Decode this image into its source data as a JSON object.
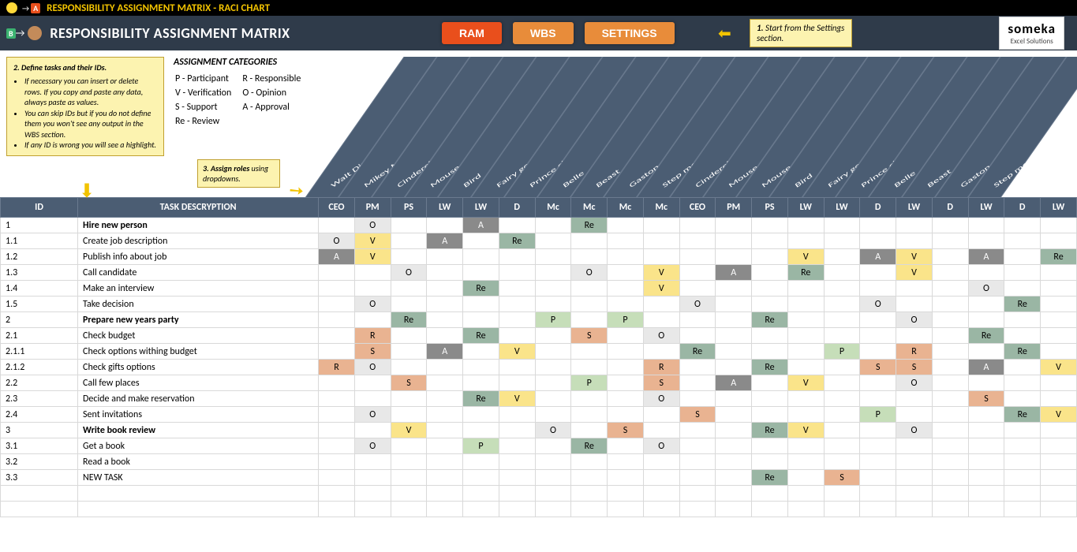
{
  "topbar": {
    "title": "RESPONSIBILITY ASSIGNMENT MATRIX - RACI CHART"
  },
  "header": {
    "title": "RESPONSIBILITY ASSIGNMENT MATRIX",
    "btn_ram": "RAM",
    "btn_wbs": "WBS",
    "btn_settings": "SETTINGS",
    "instr1_strong": "1.",
    "instr1_rest": " Start from the Settings section.",
    "logo_line1": "someka",
    "logo_line2": "Excel Solutions"
  },
  "instr2": {
    "head": "2. Define tasks and their IDs.",
    "li1": "If necessary you can insert or delete rows. If you copy and paste any data, always paste as values.",
    "li2": "You can skip IDs but if you do not define them you won't see any output in the WBS section.",
    "li3": "If any ID is wrong you will see a highlight."
  },
  "categories": {
    "head": "ASSIGNMENT CATEGORIES",
    "p": "P - Participant",
    "r": "R - Responsible",
    "v": "V - Verification",
    "o": "O - Opinion",
    "s": "S - Support",
    "a": "A - Approval",
    "re": "Re - Review"
  },
  "instr3_strong": "3. Assign roles",
  "instr3_rest": " using dropdowns.",
  "col_id": "ID",
  "col_desc": "TASK DESCRYPTION",
  "people": [
    "Walt Disney",
    "Mikey Mouse",
    "Cinderella",
    "Mouse",
    "Bird",
    "Fairy godmother",
    "Prince charming",
    "Belle",
    "Beast",
    "Gaston",
    "Step mother",
    "Cinderella",
    "Mouse",
    "Mouse",
    "Bird",
    "Fairy godmother",
    "Prince charming",
    "Belle",
    "Beast",
    "Gaston",
    "Step mother"
  ],
  "roles": [
    "CEO",
    "PM",
    "PS",
    "LW",
    "LW",
    "D",
    "Mc",
    "Mc",
    "Mc",
    "Mc",
    "CEO",
    "PM",
    "PS",
    "LW",
    "LW",
    "D",
    "LW",
    "D",
    "LW",
    "D",
    "LW"
  ],
  "rows": [
    {
      "id": "1",
      "desc": "Hire new person",
      "bold": true,
      "c": [
        "",
        "O",
        "",
        "",
        "A",
        "",
        "",
        "Re",
        "",
        "",
        "",
        "",
        "",
        "",
        "",
        "",
        "",
        "",
        "",
        "",
        ""
      ]
    },
    {
      "id": "1.1",
      "desc": "Create job description",
      "c": [
        "O",
        "V",
        "",
        "A",
        "",
        "Re",
        "",
        "",
        "",
        "",
        "",
        "",
        "",
        "",
        "",
        "",
        "",
        "",
        "",
        "",
        ""
      ]
    },
    {
      "id": "1.2",
      "desc": "Publish info about job",
      "c": [
        "A",
        "V",
        "",
        "",
        "",
        "",
        "",
        "",
        "",
        "",
        "",
        "",
        "",
        "V",
        "",
        "A",
        "V",
        "",
        "A",
        "",
        "Re"
      ]
    },
    {
      "id": "1.3",
      "desc": "Call candidate",
      "c": [
        "",
        "",
        "O",
        "",
        "",
        "",
        "",
        "O",
        "",
        "V",
        "",
        "A",
        "",
        "Re",
        "",
        "",
        "V",
        "",
        "",
        "",
        ""
      ]
    },
    {
      "id": "1.4",
      "desc": "Make an interview",
      "c": [
        "",
        "",
        "",
        "",
        "Re",
        "",
        "",
        "",
        "",
        "V",
        "",
        "",
        "",
        "",
        "",
        "",
        "",
        "",
        "O",
        "",
        ""
      ]
    },
    {
      "id": "1.5",
      "desc": "Take decision",
      "c": [
        "",
        "O",
        "",
        "",
        "",
        "",
        "",
        "",
        "",
        "",
        "O",
        "",
        "",
        "",
        "",
        "O",
        "",
        "",
        "",
        "Re",
        ""
      ]
    },
    {
      "id": "2",
      "desc": "Prepare new years party",
      "bold": true,
      "c": [
        "",
        "",
        "Re",
        "",
        "",
        "",
        "P",
        "",
        "P",
        "",
        "",
        "",
        "Re",
        "",
        "",
        "",
        "O",
        "",
        "",
        "",
        ""
      ]
    },
    {
      "id": "2.1",
      "desc": "Check budget",
      "c": [
        "",
        "R",
        "",
        "",
        "Re",
        "",
        "",
        "S",
        "",
        "O",
        "",
        "",
        "",
        "",
        "",
        "",
        "",
        "",
        "Re",
        "",
        ""
      ]
    },
    {
      "id": "2.1.1",
      "desc": "Check options withing budget",
      "c": [
        "",
        "S",
        "",
        "A",
        "",
        "V",
        "",
        "",
        "",
        "",
        "Re",
        "",
        "",
        "",
        "P",
        "",
        "R",
        "",
        "",
        "Re",
        ""
      ]
    },
    {
      "id": "2.1.2",
      "desc": "Check gifts options",
      "c": [
        "R",
        "O",
        "",
        "",
        "",
        "",
        "",
        "",
        "",
        "R",
        "",
        "",
        "Re",
        "",
        "",
        "S",
        "S",
        "",
        "A",
        "",
        "V"
      ]
    },
    {
      "id": "2.2",
      "desc": "Call few places",
      "c": [
        "",
        "",
        "S",
        "",
        "",
        "",
        "",
        "P",
        "",
        "S",
        "",
        "A",
        "",
        "V",
        "",
        "",
        "O",
        "",
        "",
        "",
        ""
      ]
    },
    {
      "id": "2.3",
      "desc": "Decide and make reservation",
      "c": [
        "",
        "",
        "",
        "",
        "Re",
        "V",
        "",
        "",
        "",
        "O",
        "",
        "",
        "",
        "",
        "",
        "",
        "",
        "",
        "S",
        "",
        ""
      ]
    },
    {
      "id": "2.4",
      "desc": "Sent invitations",
      "c": [
        "",
        "O",
        "",
        "",
        "",
        "",
        "",
        "",
        "",
        "",
        "S",
        "",
        "",
        "",
        "",
        "P",
        "",
        "",
        "",
        "Re",
        "V"
      ]
    },
    {
      "id": "3",
      "desc": "Write book review",
      "bold": true,
      "c": [
        "",
        "",
        "V",
        "",
        "",
        "",
        "O",
        "",
        "S",
        "",
        "",
        "",
        "Re",
        "V",
        "",
        "",
        "O",
        "",
        "",
        "",
        ""
      ]
    },
    {
      "id": "3.1",
      "desc": "Get a book",
      "c": [
        "",
        "O",
        "",
        "",
        "P",
        "",
        "",
        "Re",
        "",
        "O",
        "",
        "",
        "",
        "",
        "",
        "",
        "",
        "",
        "",
        "",
        ""
      ]
    },
    {
      "id": "3.2",
      "desc": "Read a book",
      "c": [
        "",
        "",
        "",
        "",
        "",
        "",
        "",
        "",
        "",
        "",
        "",
        "",
        "",
        "",
        "",
        "",
        "",
        "",
        "",
        "",
        ""
      ]
    },
    {
      "id": "3.3",
      "desc": "NEW TASK",
      "c": [
        "",
        "",
        "",
        "",
        "",
        "",
        "",
        "",
        "",
        "",
        "",
        "",
        "Re",
        "",
        "S",
        "",
        "",
        "",
        "",
        "",
        ""
      ]
    },
    {
      "id": "",
      "desc": "",
      "c": [
        "",
        "",
        "",
        "",
        "",
        "",
        "",
        "",
        "",
        "",
        "",
        "",
        "",
        "",
        "",
        "",
        "",
        "",
        "",
        "",
        ""
      ]
    },
    {
      "id": "",
      "desc": "",
      "c": [
        "",
        "",
        "",
        "",
        "",
        "",
        "",
        "",
        "",
        "",
        "",
        "",
        "",
        "",
        "",
        "",
        "",
        "",
        "",
        "",
        ""
      ]
    }
  ]
}
